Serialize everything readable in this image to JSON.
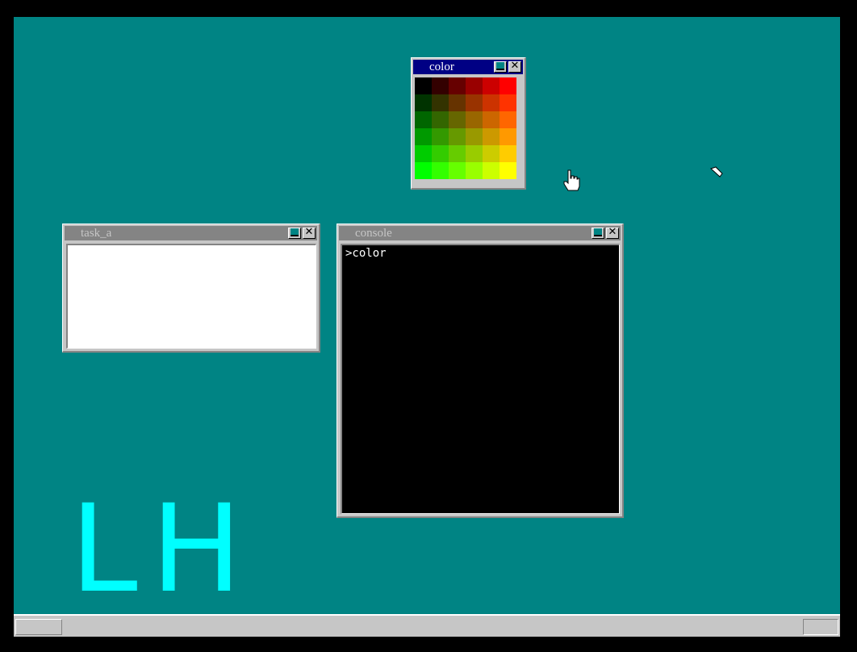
{
  "windows": {
    "color": {
      "title": "color"
    },
    "task_a": {
      "title": "task_a"
    },
    "console": {
      "title": "console",
      "prompt_line": ">color"
    }
  },
  "desktop": {
    "letter_l": "L",
    "letter_h": "H"
  },
  "palette": [
    [
      "#000000",
      "#330000",
      "#660000",
      "#990000",
      "#cc0000",
      "#ff0000"
    ],
    [
      "#003300",
      "#333300",
      "#663300",
      "#993300",
      "#cc3300",
      "#ff3300"
    ],
    [
      "#006600",
      "#336600",
      "#666600",
      "#996600",
      "#cc6600",
      "#ff6600"
    ],
    [
      "#009900",
      "#339900",
      "#669900",
      "#999900",
      "#cc9900",
      "#ff9900"
    ],
    [
      "#00cc00",
      "#33cc00",
      "#66cc00",
      "#99cc00",
      "#cccc00",
      "#ffcc00"
    ],
    [
      "#00ff00",
      "#33ff00",
      "#66ff00",
      "#99ff00",
      "#ccff00",
      "#ffff00"
    ]
  ],
  "colors": {
    "desktop": "#008484",
    "window_face": "#c6c6c6",
    "active_title": "#000084",
    "inactive_title": "#848484",
    "accent_text": "#00ffff"
  },
  "icons": [
    "minimize-icon",
    "close-icon",
    "hand-cursor-icon",
    "arrow-cursor-icon"
  ]
}
